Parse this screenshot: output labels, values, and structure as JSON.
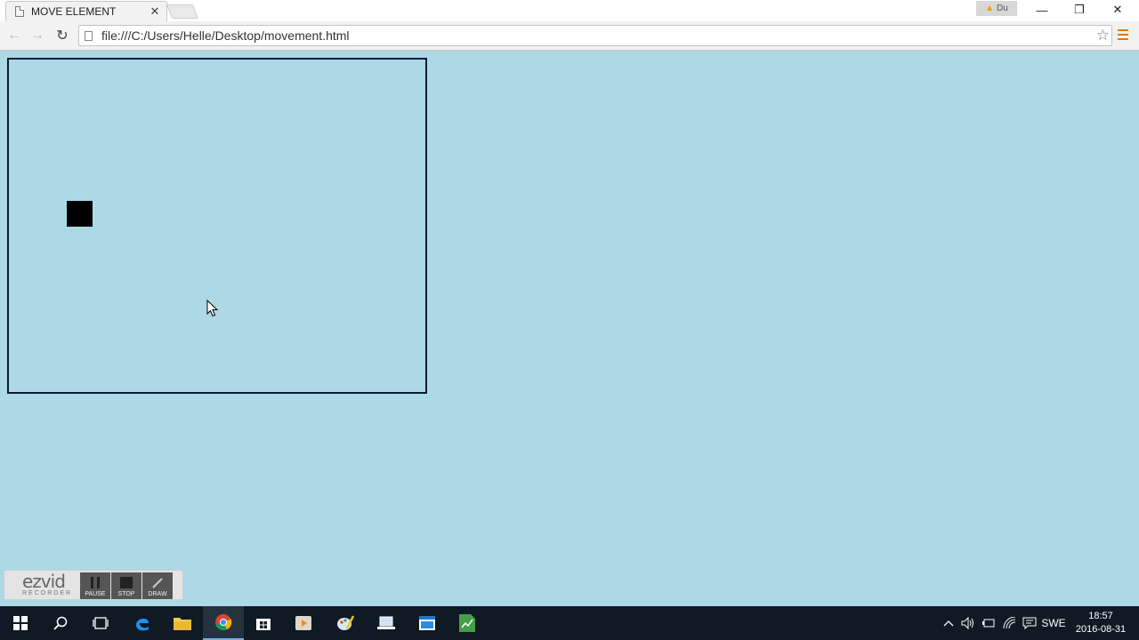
{
  "browser": {
    "tab": {
      "title": "MOVE ELEMENT",
      "close_glyph": "✕"
    },
    "profile_button": {
      "label": "Du",
      "icon": "warning-icon"
    },
    "window_controls": {
      "minimize": "—",
      "restore": "❐",
      "close": "✕"
    },
    "nav": {
      "back": "←",
      "forward": "→",
      "reload": "↻"
    },
    "address_bar": {
      "url": "file:///C:/Users/Helle/Desktop/movement.html"
    },
    "bookmark_star": "☆"
  },
  "page": {
    "background_color": "#add8e6",
    "stage_border_color": "#0b1a3a",
    "moving_element_color": "#000000"
  },
  "recorder": {
    "logo_main": "ezvid",
    "logo_sub": "RECORDER",
    "buttons": [
      {
        "label": "PAUSE"
      },
      {
        "label": "STOP"
      },
      {
        "label": "DRAW"
      }
    ]
  },
  "taskbar": {
    "items": [
      {
        "name": "start",
        "icon": "windows-icon"
      },
      {
        "name": "search",
        "icon": "search-icon"
      },
      {
        "name": "task-view",
        "icon": "task-view-icon"
      },
      {
        "name": "edge",
        "icon": "edge-icon"
      },
      {
        "name": "file-explorer",
        "icon": "folder-icon"
      },
      {
        "name": "chrome",
        "icon": "chrome-icon",
        "active": true
      },
      {
        "name": "store",
        "icon": "store-icon"
      },
      {
        "name": "media",
        "icon": "media-icon"
      },
      {
        "name": "paint",
        "icon": "paint-icon"
      },
      {
        "name": "laptop",
        "icon": "laptop-icon"
      },
      {
        "name": "window",
        "icon": "window-icon"
      },
      {
        "name": "spreadsheet",
        "icon": "spreadsheet-icon"
      }
    ],
    "tray": {
      "language": "SWE",
      "time": "18:57",
      "date": "2016-08-31"
    }
  }
}
